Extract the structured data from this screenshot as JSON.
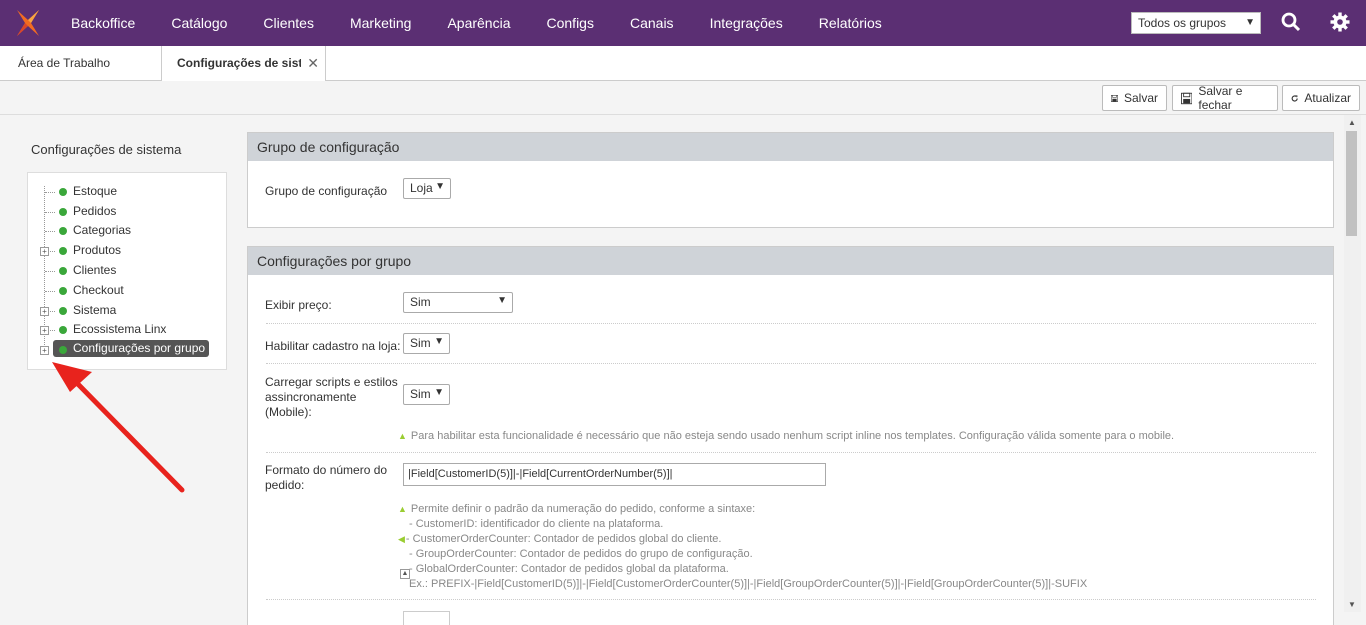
{
  "nav": {
    "items": [
      "Backoffice",
      "Catálogo",
      "Clientes",
      "Marketing",
      "Aparência",
      "Configs",
      "Canais",
      "Integrações",
      "Relatórios"
    ],
    "group_select": "Todos os grupos",
    "brand_color": "#5b2f73"
  },
  "tabs": {
    "home": "Área de Trabalho",
    "active": "Configurações de sistema",
    "close": "✕"
  },
  "toolbar": {
    "save": "Salvar",
    "save_close": "Salvar e fechar",
    "refresh": "Atualizar"
  },
  "sidebar": {
    "title": "Configurações de sistema",
    "items": [
      {
        "label": "Estoque",
        "expandable": false
      },
      {
        "label": "Pedidos",
        "expandable": false
      },
      {
        "label": "Categorias",
        "expandable": false
      },
      {
        "label": "Produtos",
        "expandable": true
      },
      {
        "label": "Clientes",
        "expandable": false
      },
      {
        "label": "Checkout",
        "expandable": false
      },
      {
        "label": "Sistema",
        "expandable": true
      },
      {
        "label": "Ecossistema Linx",
        "expandable": true
      },
      {
        "label": "Configurações por grupo",
        "expandable": true,
        "selected": true
      }
    ]
  },
  "config_group": {
    "header": "Grupo de configuração",
    "label": "Grupo de configuração",
    "value": "Loja"
  },
  "group_settings": {
    "header": "Configurações por grupo",
    "show_price": {
      "label": "Exibir preço:",
      "value": "Sim"
    },
    "store_signup": {
      "label": "Habilitar cadastro na loja:",
      "value": "Sim"
    },
    "async_scripts": {
      "label_lines": [
        "Carregar scripts e estilos",
        "assincronamente",
        "(Mobile):"
      ],
      "value": "Sim",
      "hint": "Para habilitar esta funcionalidade é necessário que não esteja sendo usado nenhum script inline nos templates. Configuração válida somente para o mobile."
    },
    "order_number": {
      "label_lines": [
        "Formato do número do",
        "pedido:"
      ],
      "value": "|Field[CustomerID(5)]|-|Field[CurrentOrderNumber(5)]|",
      "hint_lines": [
        "Permite definir o padrão da numeração do pedido, conforme a sintaxe:",
        "- CustomerID: identificador do cliente na plataforma.",
        "- CustomerOrderCounter: Contador de pedidos global do cliente.",
        "- GroupOrderCounter: Contador de pedidos do grupo de configuração.",
        "- GlobalOrderCounter: Contador de pedidos global da plataforma.",
        "Ex.: PREFIX-|Field[CustomerID(5)]|-|Field[CustomerOrderCounter(5)]|-|Field[GroupOrderCounter(5)]|-|Field[GroupOrderCounter(5)]|-SUFIX"
      ]
    }
  },
  "annotation": {
    "arrow_color": "#e8231d"
  }
}
